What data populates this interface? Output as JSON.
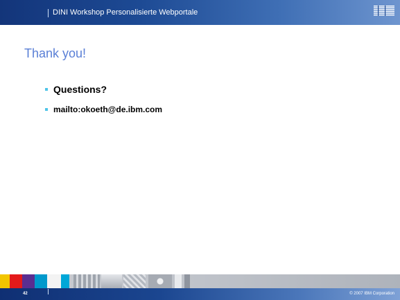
{
  "header": {
    "title": "DINI Workshop Personalisierte Webportale",
    "logo_text": "IBM"
  },
  "slide": {
    "title": "Thank you!",
    "bullets": [
      "Questions?",
      "mailto:okoeth@de.ibm.com"
    ]
  },
  "footer": {
    "page_number": "42",
    "copyright": "© 2007 IBM Corporation"
  },
  "colors": {
    "header_bar": "#1d4a94",
    "title_text": "#5a7fd6",
    "bullet_marker": "#4fc4e8",
    "footer_blocks": [
      "#f2c500",
      "#e41a1a",
      "#5a2e91",
      "#0099cc",
      "#00a7d8"
    ]
  },
  "icons": [
    "ibm-logo",
    "bullet-square-icon",
    "decorative-tile-strip"
  ]
}
